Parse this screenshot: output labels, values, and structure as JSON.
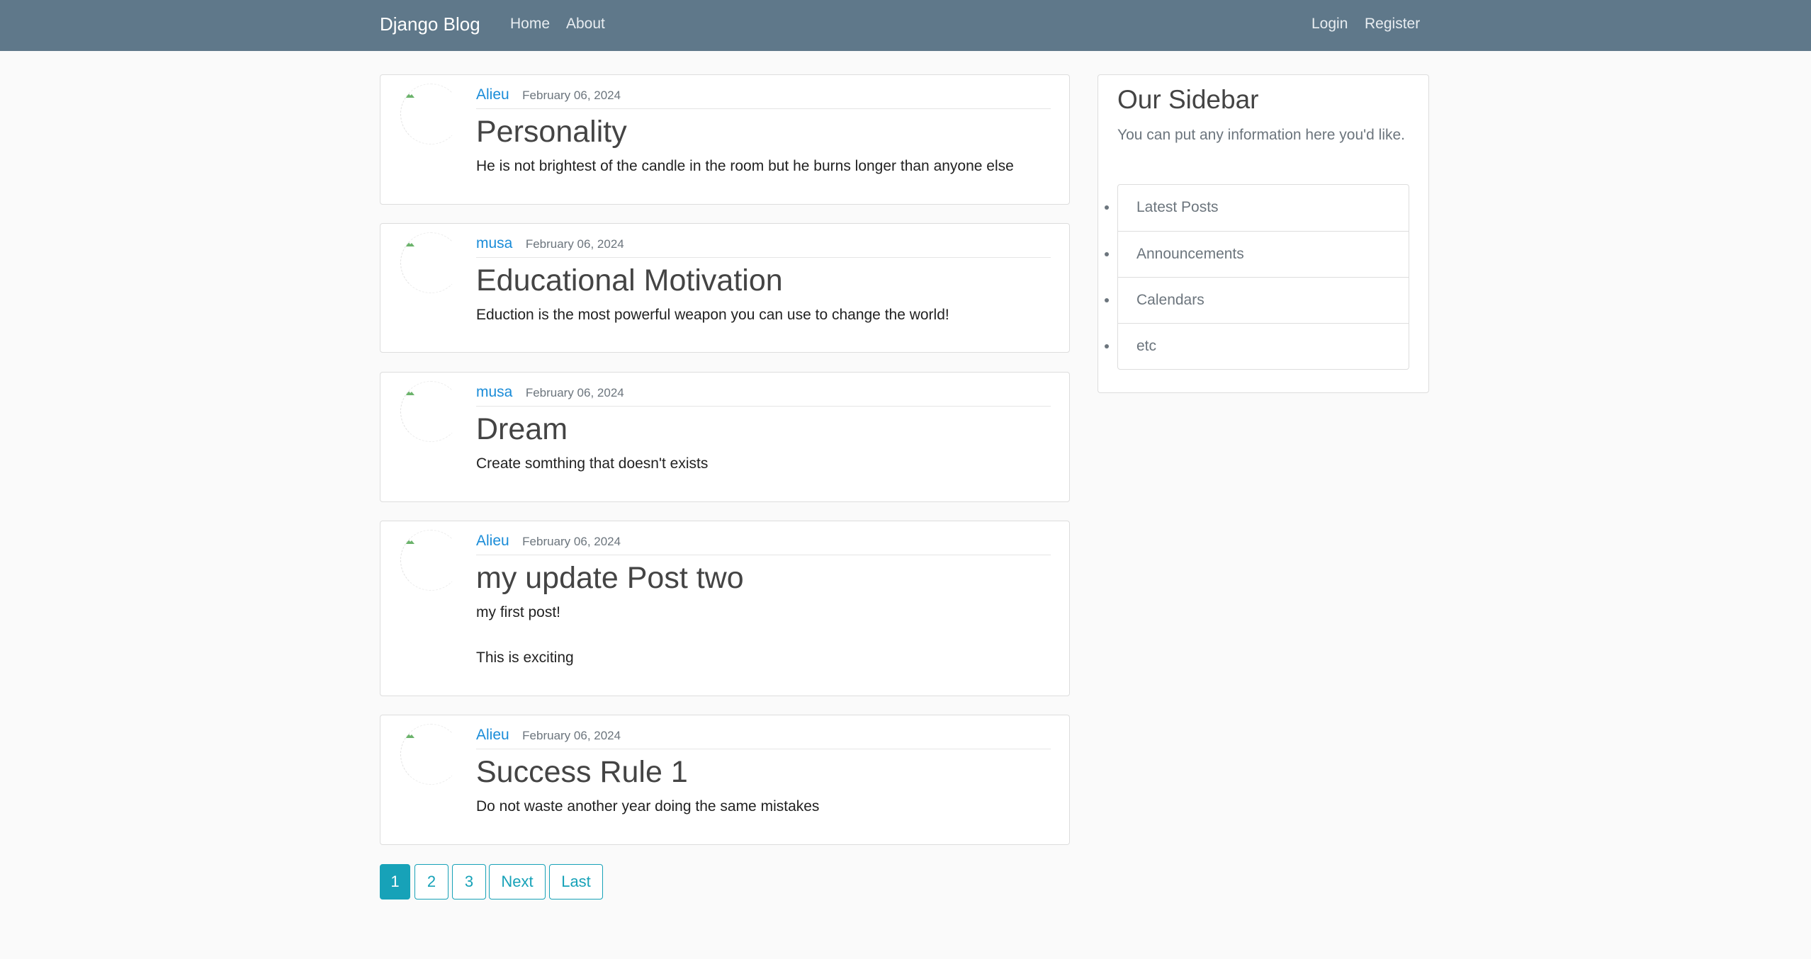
{
  "navbar": {
    "brand": "Django Blog",
    "links_left": [
      "Home",
      "About"
    ],
    "links_right": [
      "Login",
      "Register"
    ]
  },
  "posts": [
    {
      "author": "Alieu",
      "date": "February 06, 2024",
      "title": "Personality",
      "content": [
        "He is not brightest of the candle in the room but he burns longer than anyone else"
      ]
    },
    {
      "author": "musa",
      "date": "February 06, 2024",
      "title": "Educational Motivation",
      "content": [
        "Eduction is the most powerful weapon you can use to change the world!"
      ]
    },
    {
      "author": "musa",
      "date": "February 06, 2024",
      "title": "Dream",
      "content": [
        "Create somthing that doesn't exists"
      ]
    },
    {
      "author": "Alieu",
      "date": "February 06, 2024",
      "title": "my update Post two",
      "content": [
        "my first post!",
        "This is exciting"
      ]
    },
    {
      "author": "Alieu",
      "date": "February 06, 2024",
      "title": "Success Rule 1",
      "content": [
        "Do not waste another year doing the same mistakes"
      ]
    }
  ],
  "pagination": {
    "pages": [
      "1",
      "2",
      "3"
    ],
    "current": "1",
    "next_label": "Next",
    "last_label": "Last"
  },
  "sidebar": {
    "title": "Our Sidebar",
    "description": "You can put any information here you'd like.",
    "items": [
      "Latest Posts",
      "Announcements",
      "Calendars",
      "etc"
    ]
  },
  "colors": {
    "navbar_bg": "#5f788a",
    "page_bg": "#fafafa",
    "link": "#1a8cd8",
    "pagination_accent": "#17a2b8"
  },
  "icons": {
    "avatar": "broken-image-icon"
  }
}
